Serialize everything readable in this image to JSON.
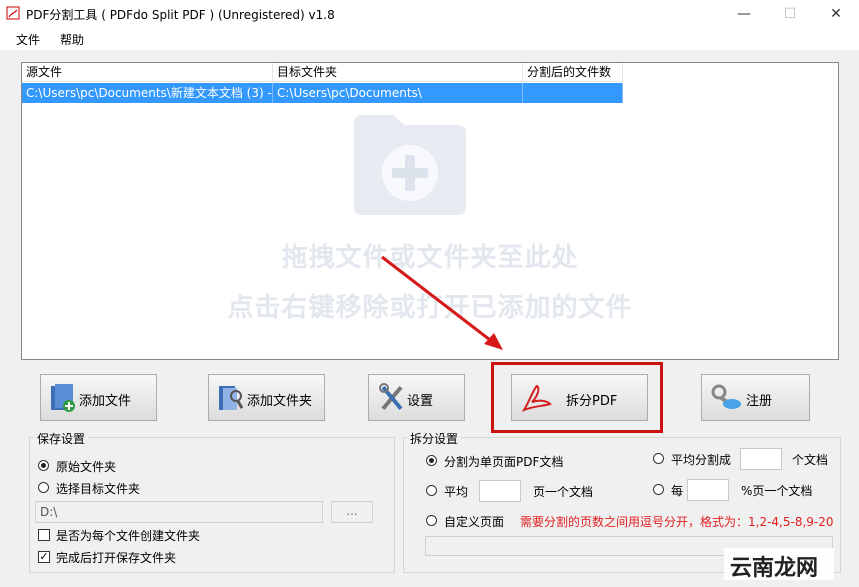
{
  "window": {
    "title": "PDF分割工具 ( PDFdo Split PDF ) (Unregistered) v1.8",
    "minimize": "—",
    "maximize": "☐",
    "close": "✕"
  },
  "menu": {
    "file": "文件",
    "help": "帮助"
  },
  "list": {
    "columns": [
      "源文件",
      "目标文件夹",
      "分割后的文件数"
    ],
    "rows": [
      {
        "source": "C:\\Users\\pc\\Documents\\新建文本文档 (3) -...",
        "target": "C:\\Users\\pc\\Documents\\",
        "count": ""
      }
    ],
    "hint_line1": "拖拽文件或文件夹至此处",
    "hint_line2": "点击右键移除或打开已添加的文件"
  },
  "buttons": {
    "add_file": "添加文件",
    "add_folder": "添加文件夹",
    "settings": "设置",
    "split": "拆分PDF",
    "register": "注册"
  },
  "save": {
    "title": "保存设置",
    "opt_original": "原始文件夹",
    "opt_target": "选择目标文件夹",
    "path_value": "D:\\",
    "browse": "...",
    "create_folder": "是否为每个文件创建文件夹",
    "open_after": "完成后打开保存文件夹"
  },
  "split": {
    "title": "拆分设置",
    "opt_single": "分割为单页面PDF文档",
    "opt_avg_split": "平均分割成",
    "unit_docs": "个文档",
    "opt_avg": "平均",
    "unit_pages_one": "页一个文档",
    "opt_every": "每",
    "unit_percent": "%页一个文档",
    "opt_custom": "自定义页面",
    "custom_hint": "需要分割的页数之间用逗号分开，格式为：1,2-4,5-8,9-20",
    "avg_split_value": "",
    "avg_value": "",
    "every_value": "",
    "custom_value": ""
  },
  "watermark": "云南龙网",
  "colors": {
    "selection": "#3399ff",
    "highlight": "#e02020",
    "accent_red": "#cc1111"
  }
}
